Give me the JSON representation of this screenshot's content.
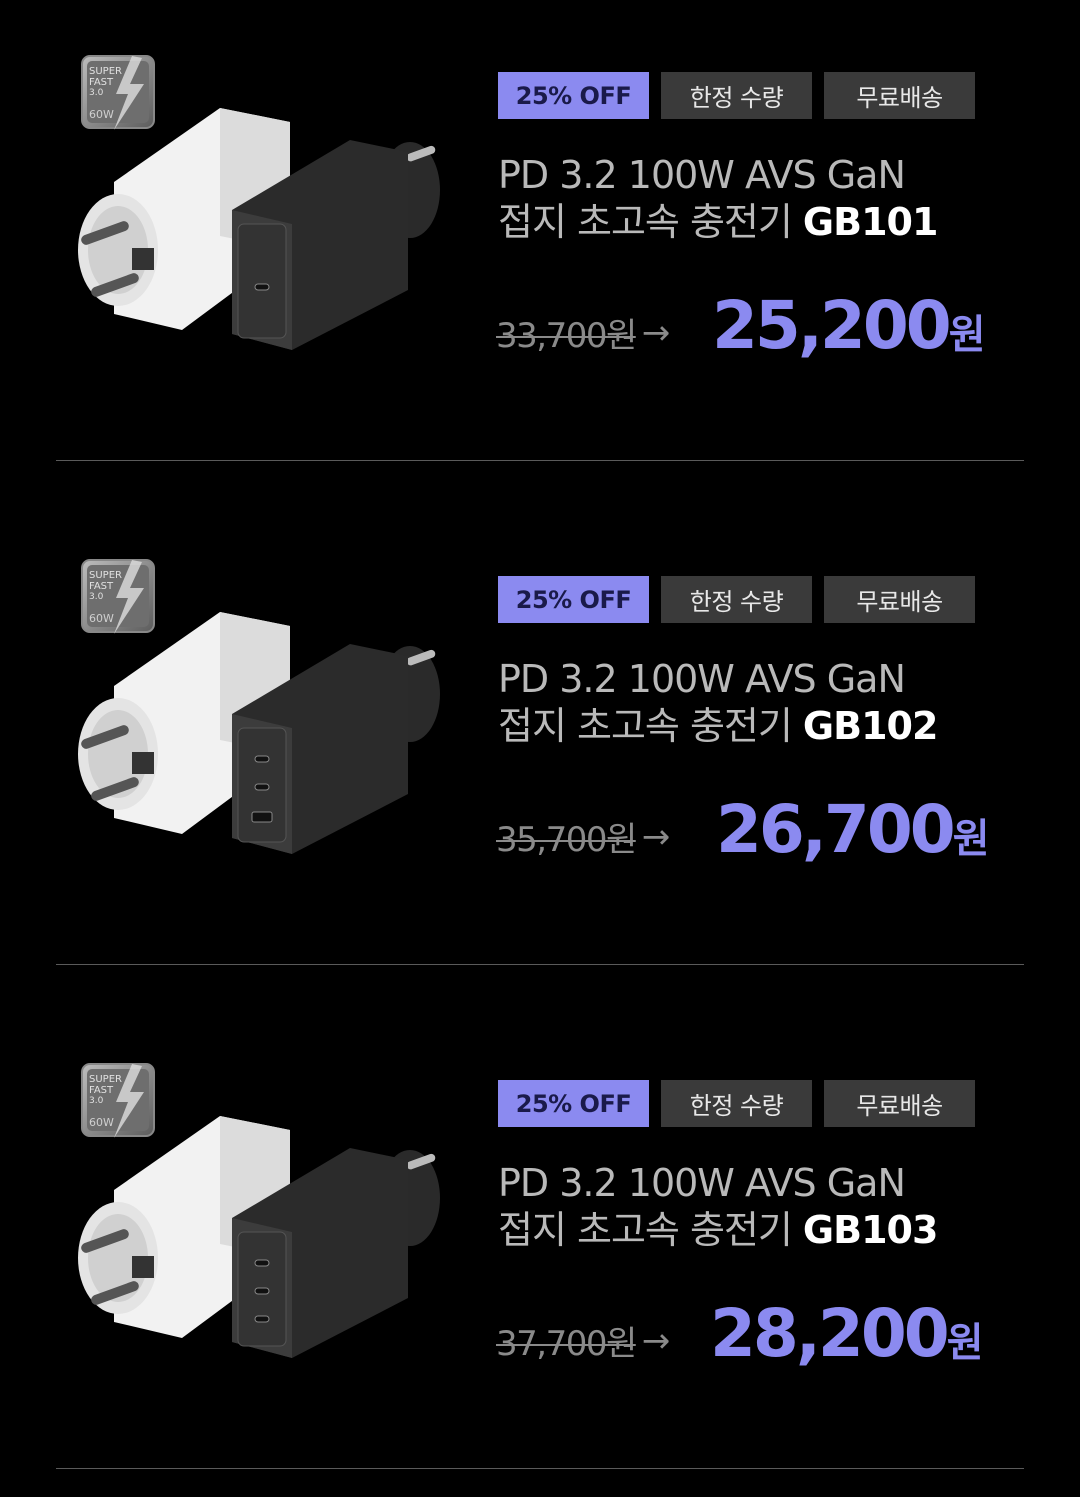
{
  "products": [
    {
      "badge": {
        "line1": "SUPER",
        "line2": "FAST",
        "line3": "3.0",
        "watt": "60W",
        "icon": "lightning-icon"
      },
      "tags": [
        "25% OFF",
        "한정 수량",
        "무료배송"
      ],
      "title_line1": "PD 3.2 100W AVS GaN",
      "title_line2_prefix": "접지 초고속 충전기 ",
      "model": "GB101",
      "old_price": "33,700원",
      "arrow": "→",
      "new_price_value": "25,200",
      "new_price_unit": "원",
      "ports": [
        "usb-c"
      ]
    },
    {
      "badge": {
        "line1": "SUPER",
        "line2": "FAST",
        "line3": "3.0",
        "watt": "60W",
        "icon": "lightning-icon"
      },
      "tags": [
        "25% OFF",
        "한정 수량",
        "무료배송"
      ],
      "title_line1": "PD 3.2 100W AVS GaN",
      "title_line2_prefix": "접지 초고속 충전기 ",
      "model": "GB102",
      "old_price": "35,700원",
      "arrow": "→",
      "new_price_value": "26,700",
      "new_price_unit": "원",
      "ports": [
        "usb-c",
        "usb-c",
        "usb-a"
      ]
    },
    {
      "badge": {
        "line1": "SUPER",
        "line2": "FAST",
        "line3": "3.0",
        "watt": "60W",
        "icon": "lightning-icon"
      },
      "tags": [
        "25% OFF",
        "한정 수량",
        "무료배송"
      ],
      "title_line1": "PD 3.2 100W AVS GaN",
      "title_line2_prefix": "접지 초고속 충전기 ",
      "model": "GB103",
      "old_price": "37,700원",
      "arrow": "→",
      "new_price_value": "28,200",
      "new_price_unit": "원",
      "ports": [
        "usb-c",
        "usb-c",
        "usb-c"
      ]
    }
  ],
  "colors": {
    "accent": "#8b8af0",
    "tag_bg": "#3a3a3a",
    "background": "#000000"
  }
}
